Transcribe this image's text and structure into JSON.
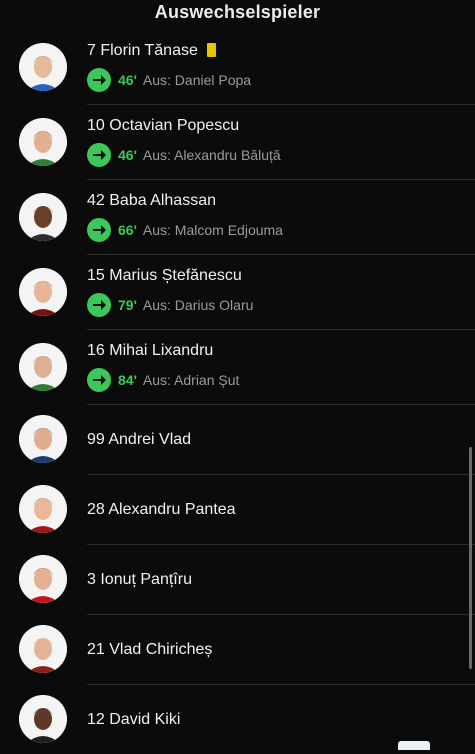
{
  "header": {
    "title": "Auswechselspieler"
  },
  "players": [
    {
      "label": "7 Florin Tănase",
      "yellow_card": true,
      "sub_minute": "46'",
      "sub_text": "Aus: Daniel Popa",
      "avatar_hair": "#6b4f3a",
      "avatar_shirt": "#2b5fbf",
      "avatar_skin": "#e7b89a"
    },
    {
      "label": "10 Octavian Popescu",
      "sub_minute": "46'",
      "sub_text": "Aus: Alexandru Băluță",
      "avatar_hair": "#2a1f19",
      "avatar_shirt": "#2e7d32",
      "avatar_skin": "#e3b08f"
    },
    {
      "label": "42 Baba Alhassan",
      "sub_minute": "66'",
      "sub_text": "Aus: Malcom Edjouma",
      "avatar_hair": "#151010",
      "avatar_shirt": "#2d2d2d",
      "avatar_skin": "#6a3f28"
    },
    {
      "label": "15 Marius Ștefănescu",
      "sub_minute": "79'",
      "sub_text": "Aus: Darius Olaru",
      "avatar_hair": "#3b2a20",
      "avatar_shirt": "#7a1010",
      "avatar_skin": "#e8b596"
    },
    {
      "label": "16 Mihai Lixandru",
      "sub_minute": "84'",
      "sub_text": "Aus: Adrian Șut",
      "avatar_hair": "#4a3526",
      "avatar_shirt": "#2e7d32",
      "avatar_skin": "#ddb093"
    },
    {
      "label": "99 Andrei Vlad",
      "avatar_hair": "#1c1714",
      "avatar_shirt": "#1e3c72",
      "avatar_skin": "#e1ae8d"
    },
    {
      "label": "28 Alexandru Pantea",
      "avatar_hair": "#6a4a32",
      "avatar_shirt": "#a0161a",
      "avatar_skin": "#eab899"
    },
    {
      "label": "3 Ionuț Panțîru",
      "avatar_hair": "#241a14",
      "avatar_shirt": "#c0161d",
      "avatar_skin": "#e4b090"
    },
    {
      "label": "21 Vlad Chiricheș",
      "avatar_hair": "#c9a58a",
      "avatar_shirt": "#8a1f1f",
      "avatar_skin": "#e2b495"
    },
    {
      "label": "12 David Kiki",
      "avatar_hair": "#0f0b0a",
      "avatar_shirt": "#1f1f1f",
      "avatar_skin": "#5e3a26"
    }
  ]
}
